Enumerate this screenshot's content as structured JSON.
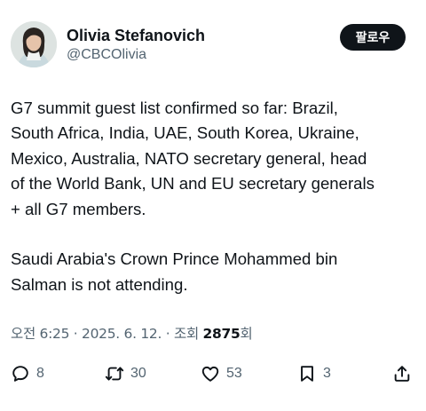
{
  "author": {
    "display_name": "Olivia Stefanovich",
    "handle": "@CBCOlivia"
  },
  "follow_button": "팔로우",
  "tweet": {
    "text": "G7 summit guest list confirmed so far: Brazil,\nSouth Africa, India, UAE, South Korea, Ukraine,\nMexico, Australia, NATO secretary general, head\nof the World Bank, UN and EU secretary generals\n+ all G7 members.\n\nSaudi Arabia's Crown Prince Mohammed bin\nSalman is not attending."
  },
  "meta": {
    "time_date": "오전 6:25 · 2025. 6. 12. · 조회 ",
    "views": "2875",
    "views_suffix": "회"
  },
  "actions": {
    "replies": "8",
    "reposts": "30",
    "likes": "53",
    "bookmarks": "3"
  },
  "icons": [
    "reply-icon",
    "repost-icon",
    "like-icon",
    "bookmark-icon",
    "share-icon"
  ]
}
